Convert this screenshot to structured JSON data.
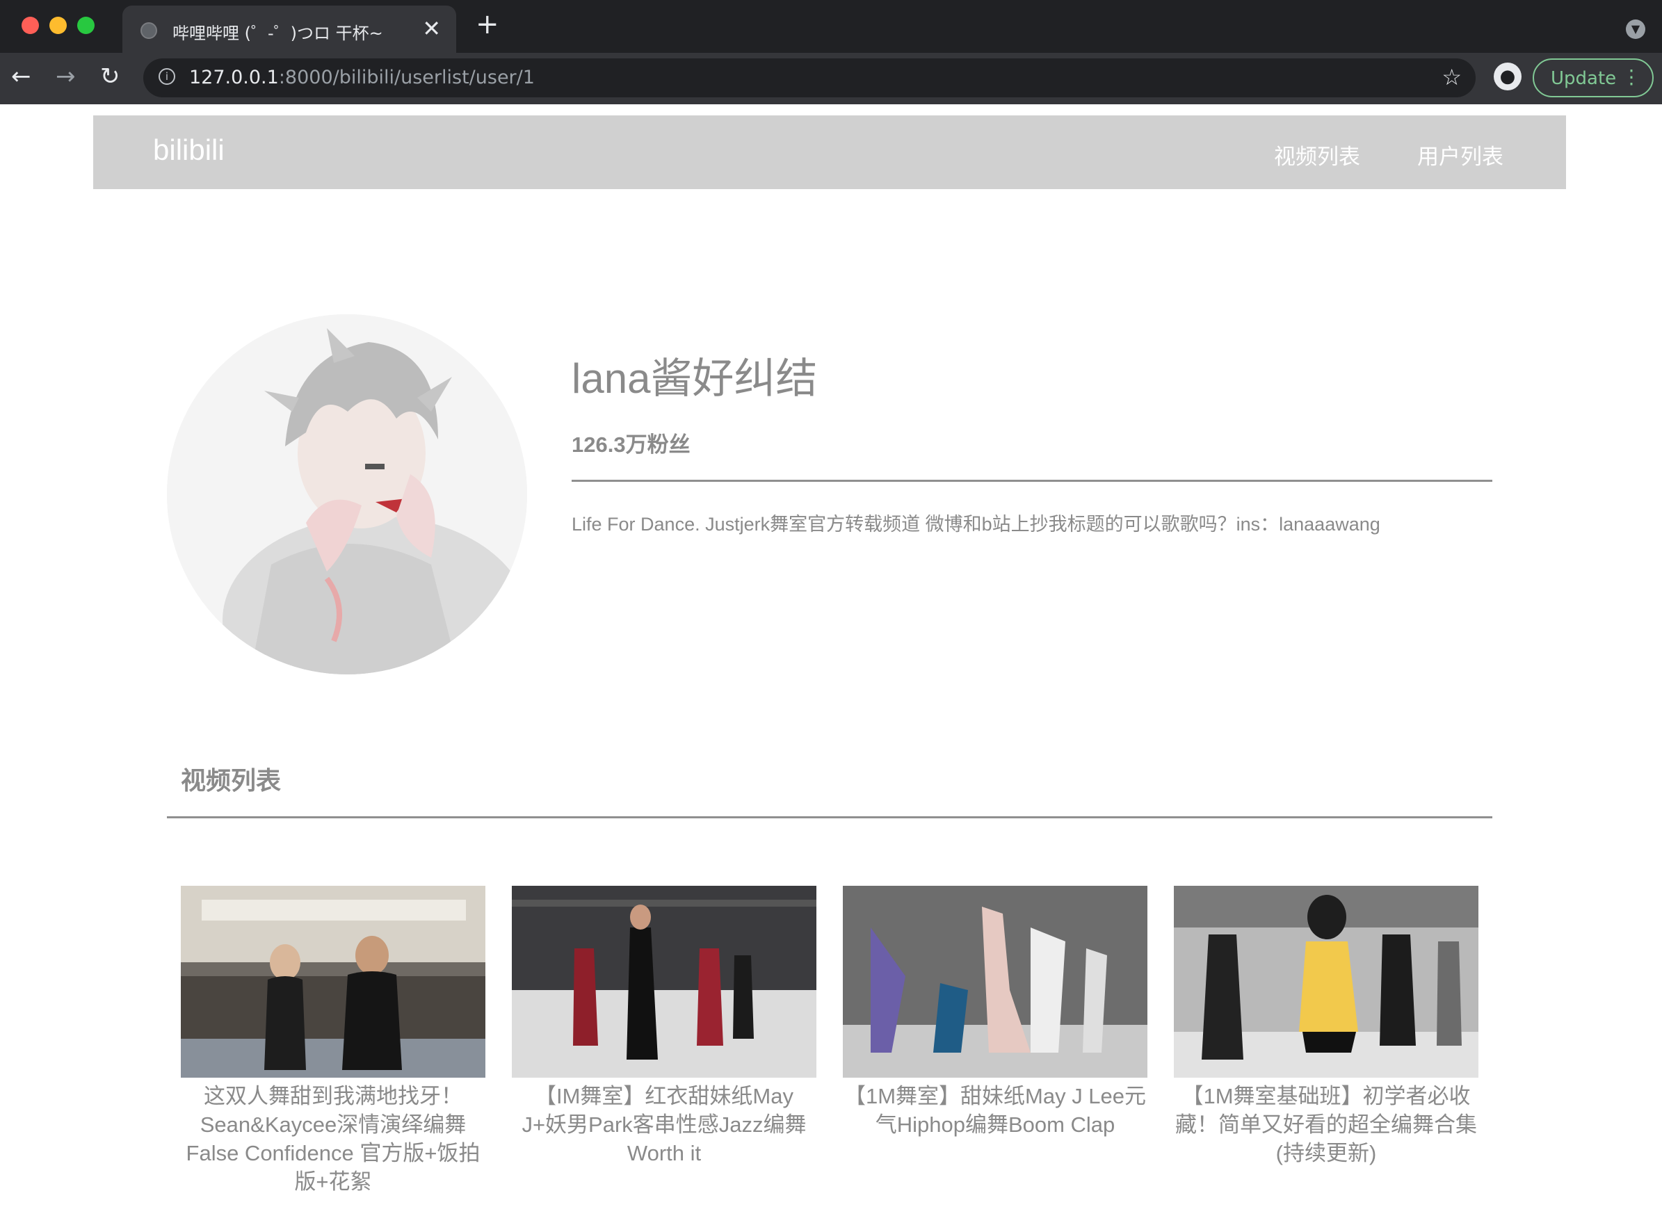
{
  "browser": {
    "tab_title": "哔哩哔哩 (゜-゜)つロ 干杯~",
    "url_host": "127.0.0.1",
    "url_path": ":8000/bilibili/userlist/user/1",
    "update_label": "Update",
    "window_controls": {
      "close": "#ff5f57",
      "minimize": "#febc2e",
      "maximize": "#28c840"
    }
  },
  "nav": {
    "brand": "bilibili",
    "links": [
      "视频列表",
      "用户列表"
    ]
  },
  "profile": {
    "name": "lana酱好纠结",
    "fans": "126.3万粉丝",
    "bio": "Life For Dance. Justjerk舞室官方转载频道 微博和b站上抄我标题的可以歌歌吗？ins：lanaaawang"
  },
  "videos_section": {
    "title": "视频列表",
    "videos": [
      {
        "title": "这双人舞甜到我满地找牙！Sean&Kaycee深情演绎编舞False Confidence 官方版+饭拍版+花絮"
      },
      {
        "title": "【IM舞室】红衣甜妹纸May J+妖男Park客串性感Jazz编舞Worth it"
      },
      {
        "title": "【1M舞室】甜妹纸May J Lee元气Hiphop编舞Boom Clap"
      },
      {
        "title": "【1M舞室基础班】初学者必收藏！简单又好看的超全编舞合集(持续更新)"
      }
    ]
  },
  "icons": [
    "globe-icon",
    "close-icon",
    "plus-icon",
    "back-arrow-icon",
    "forward-arrow-icon",
    "reload-icon",
    "info-icon",
    "star-icon",
    "profile-icon",
    "kebab-menu-icon",
    "tab-search-icon"
  ]
}
